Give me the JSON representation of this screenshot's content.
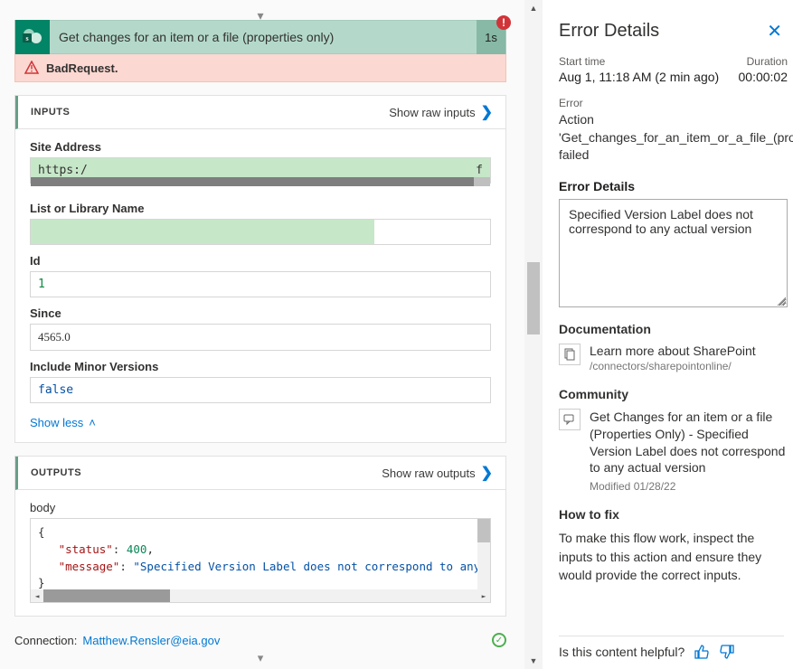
{
  "left": {
    "action_title": "Get changes for an item or a file (properties only)",
    "action_time": "1s",
    "bad_request": "BadRequest.",
    "inputs": {
      "title": "INPUTS",
      "raw_link": "Show raw inputs",
      "fields": {
        "site_address_label": "Site Address",
        "site_address_value": "https:/",
        "site_address_suffix": "f",
        "list_label": "List or Library Name",
        "id_label": "Id",
        "id_value": "1",
        "since_label": "Since",
        "since_value": "4565.0",
        "minor_label": "Include Minor Versions",
        "minor_value": "false"
      },
      "show_less": "Show less"
    },
    "outputs": {
      "title": "OUTPUTS",
      "raw_link": "Show raw outputs",
      "body_label": "body",
      "body_json": {
        "open": "{",
        "l1_key": "\"status\"",
        "l1_sep": ": ",
        "l1_val": "400",
        "l1_end": ",",
        "l2_key": "\"message\"",
        "l2_sep": ": ",
        "l2_val": "\"Specified Version Label does not correspond to any a",
        "close": "}"
      }
    },
    "connection_label": "Connection:",
    "connection_email": "Matthew.Rensler@eia.gov"
  },
  "right": {
    "title": "Error Details",
    "start_label": "Start time",
    "start_value": "Aug 1, 11:18 AM (2 min ago)",
    "duration_label": "Duration",
    "duration_value": "00:00:02",
    "error_label": "Error",
    "error_action": "Action 'Get_changes_for_an_item_or_a_file_(properties_ failed",
    "error_details_label": "Error Details",
    "error_details_text": "Specified Version Label does not correspond to any actual version",
    "doc_heading": "Documentation",
    "doc_link": "Learn more about SharePoint",
    "doc_path": "/connectors/sharepointonline/",
    "community_heading": "Community",
    "community_title": "Get Changes for an item or a file (Properties Only) - Specified Version Label does not correspond to any actual version",
    "community_date": "Modified 01/28/22",
    "howto_heading": "How to fix",
    "howto_text": "To make this flow work, inspect the inputs to this action and ensure they would provide the correct inputs.",
    "helpful_label": "Is this content helpful?"
  }
}
